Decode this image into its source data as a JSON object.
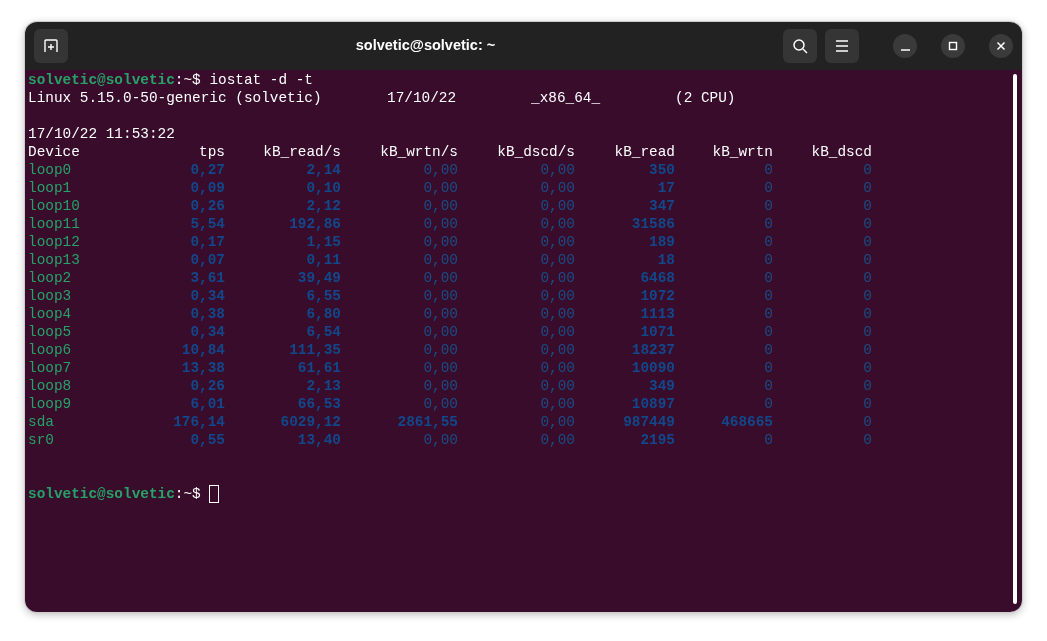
{
  "window": {
    "title": "solvetic@solvetic: ~"
  },
  "terminal": {
    "command_prompt": {
      "user": "solvetic@solvetic",
      "separator": ":",
      "path": "~",
      "symbol": "$",
      "command": "iostat -d -t"
    },
    "system_line": [
      "Linux 5.15.0-50-generic (solvetic)",
      "17/10/22",
      "_x86_64_",
      "(2 CPU)"
    ],
    "timestamp": "17/10/22 11:53:22",
    "table": {
      "columns": [
        "Device",
        "tps",
        "kB_read/s",
        "kB_wrtn/s",
        "kB_dscd/s",
        "kB_read",
        "kB_wrtn",
        "kB_dscd"
      ],
      "rows": [
        {
          "device": "loop0",
          "values": [
            "0,27",
            "2,14",
            "0,00",
            "0,00",
            "350",
            "0",
            "0"
          ],
          "dim": [
            false,
            false,
            true,
            true,
            false,
            true,
            true
          ]
        },
        {
          "device": "loop1",
          "values": [
            "0,09",
            "0,10",
            "0,00",
            "0,00",
            "17",
            "0",
            "0"
          ],
          "dim": [
            false,
            false,
            true,
            true,
            false,
            true,
            true
          ]
        },
        {
          "device": "loop10",
          "values": [
            "0,26",
            "2,12",
            "0,00",
            "0,00",
            "347",
            "0",
            "0"
          ],
          "dim": [
            false,
            false,
            true,
            true,
            false,
            true,
            true
          ]
        },
        {
          "device": "loop11",
          "values": [
            "5,54",
            "192,86",
            "0,00",
            "0,00",
            "31586",
            "0",
            "0"
          ],
          "dim": [
            false,
            false,
            true,
            true,
            false,
            true,
            true
          ]
        },
        {
          "device": "loop12",
          "values": [
            "0,17",
            "1,15",
            "0,00",
            "0,00",
            "189",
            "0",
            "0"
          ],
          "dim": [
            false,
            false,
            true,
            true,
            false,
            true,
            true
          ]
        },
        {
          "device": "loop13",
          "values": [
            "0,07",
            "0,11",
            "0,00",
            "0,00",
            "18",
            "0",
            "0"
          ],
          "dim": [
            false,
            false,
            true,
            true,
            false,
            true,
            true
          ]
        },
        {
          "device": "loop2",
          "values": [
            "3,61",
            "39,49",
            "0,00",
            "0,00",
            "6468",
            "0",
            "0"
          ],
          "dim": [
            false,
            false,
            true,
            true,
            false,
            true,
            true
          ]
        },
        {
          "device": "loop3",
          "values": [
            "0,34",
            "6,55",
            "0,00",
            "0,00",
            "1072",
            "0",
            "0"
          ],
          "dim": [
            false,
            false,
            true,
            true,
            false,
            true,
            true
          ]
        },
        {
          "device": "loop4",
          "values": [
            "0,38",
            "6,80",
            "0,00",
            "0,00",
            "1113",
            "0",
            "0"
          ],
          "dim": [
            false,
            false,
            true,
            true,
            false,
            true,
            true
          ]
        },
        {
          "device": "loop5",
          "values": [
            "0,34",
            "6,54",
            "0,00",
            "0,00",
            "1071",
            "0",
            "0"
          ],
          "dim": [
            false,
            false,
            true,
            true,
            false,
            true,
            true
          ]
        },
        {
          "device": "loop6",
          "values": [
            "10,84",
            "111,35",
            "0,00",
            "0,00",
            "18237",
            "0",
            "0"
          ],
          "dim": [
            false,
            false,
            true,
            true,
            false,
            true,
            true
          ]
        },
        {
          "device": "loop7",
          "values": [
            "13,38",
            "61,61",
            "0,00",
            "0,00",
            "10090",
            "0",
            "0"
          ],
          "dim": [
            false,
            false,
            true,
            true,
            false,
            true,
            true
          ]
        },
        {
          "device": "loop8",
          "values": [
            "0,26",
            "2,13",
            "0,00",
            "0,00",
            "349",
            "0",
            "0"
          ],
          "dim": [
            false,
            false,
            true,
            true,
            false,
            true,
            true
          ]
        },
        {
          "device": "loop9",
          "values": [
            "6,01",
            "66,53",
            "0,00",
            "0,00",
            "10897",
            "0",
            "0"
          ],
          "dim": [
            false,
            false,
            true,
            true,
            false,
            true,
            true
          ]
        },
        {
          "device": "sda",
          "values": [
            "176,14",
            "6029,12",
            "2861,55",
            "0,00",
            "987449",
            "468665",
            "0"
          ],
          "dim": [
            false,
            false,
            false,
            true,
            false,
            false,
            true
          ]
        },
        {
          "device": "sr0",
          "values": [
            "0,55",
            "13,40",
            "0,00",
            "0,00",
            "2195",
            "0",
            "0"
          ],
          "dim": [
            false,
            false,
            true,
            true,
            false,
            true,
            true
          ]
        }
      ]
    },
    "final_prompt": {
      "user": "solvetic@solvetic",
      "separator": ":",
      "path": "~",
      "symbol": "$"
    },
    "cursor": {
      "focused": false
    }
  }
}
